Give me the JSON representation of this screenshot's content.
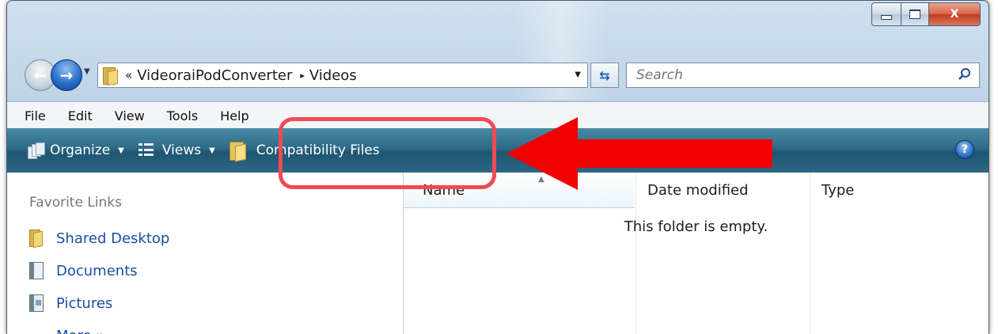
{
  "window": {
    "caption_buttons": {
      "minimize": "minimize-icon",
      "maximize": "maximize-icon",
      "close": "X"
    }
  },
  "address_bar": {
    "breadcrumb_prefix": "«",
    "path": [
      "VideoraiPodConverter",
      "Videos"
    ],
    "path_separator": "▸",
    "search_placeholder": "Search"
  },
  "menu": [
    "File",
    "Edit",
    "View",
    "Tools",
    "Help"
  ],
  "command_bar": {
    "organize_label": "Organize",
    "views_label": "Views",
    "compat_label": "Compatibility Files",
    "help_label": "?"
  },
  "nav_pane": {
    "header": "Favorite Links",
    "items": [
      {
        "label": "Shared Desktop",
        "icon": "folder-icon"
      },
      {
        "label": "Documents",
        "icon": "documents-icon"
      },
      {
        "label": "Pictures",
        "icon": "pictures-icon"
      },
      {
        "label": "More »",
        "icon": ""
      }
    ]
  },
  "file_list": {
    "columns": [
      "Name",
      "Date modified",
      "Type"
    ],
    "empty_message": "This folder is empty."
  },
  "annotation": {
    "highlight_color": "#f04a54",
    "arrow_color": "#f20000"
  }
}
